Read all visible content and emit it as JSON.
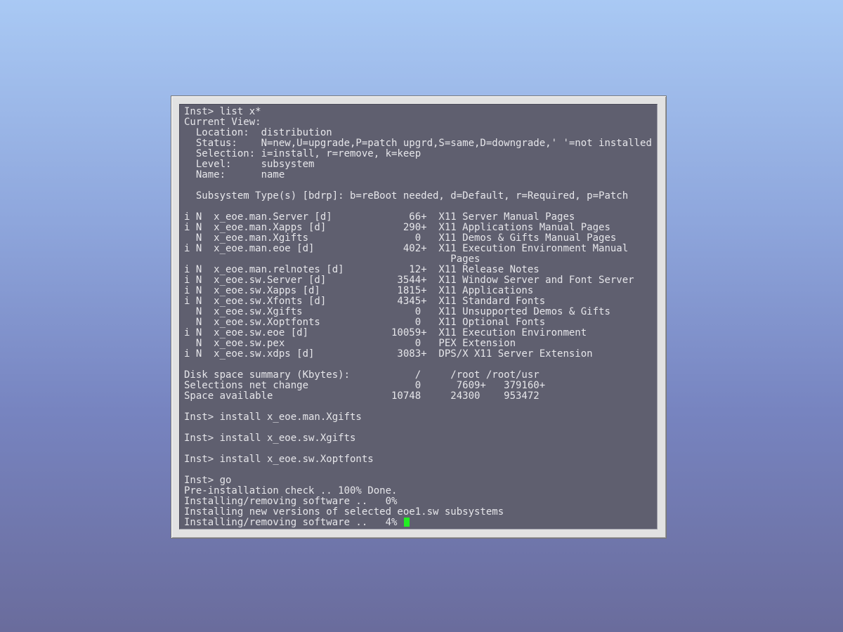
{
  "terminal": {
    "lines": [
      "Inst> list x*",
      "Current View:",
      "  Location:  distribution",
      "  Status:    N=new,U=upgrade,P=patch upgrd,S=same,D=downgrade,' '=not installed",
      "  Selection: i=install, r=remove, k=keep",
      "  Level:     subsystem",
      "  Name:      name",
      "",
      "  Subsystem Type(s) [bdrp]: b=reBoot needed, d=Default, r=Required, p=Patch",
      "",
      "i N  x_eoe.man.Server [d]             66+  X11 Server Manual Pages",
      "i N  x_eoe.man.Xapps [d]             290+  X11 Applications Manual Pages",
      "  N  x_eoe.man.Xgifts                  0   X11 Demos & Gifts Manual Pages",
      "i N  x_eoe.man.eoe [d]               402+  X11 Execution Environment Manual",
      "                                             Pages",
      "i N  x_eoe.man.relnotes [d]           12+  X11 Release Notes",
      "i N  x_eoe.sw.Server [d]            3544+  X11 Window Server and Font Server",
      "i N  x_eoe.sw.Xapps [d]             1815+  X11 Applications",
      "i N  x_eoe.sw.Xfonts [d]            4345+  X11 Standard Fonts",
      "  N  x_eoe.sw.Xgifts                   0   X11 Unsupported Demos & Gifts",
      "  N  x_eoe.sw.Xoptfonts                0   X11 Optional Fonts",
      "i N  x_eoe.sw.eoe [d]              10059+  X11 Execution Environment",
      "  N  x_eoe.sw.pex                      0   PEX Extension",
      "i N  x_eoe.sw.xdps [d]              3083+  DPS/X X11 Server Extension",
      "",
      "Disk space summary (Kbytes):           /     /root /root/usr",
      "Selections net change                  0      7609+   379160+",
      "Space available                    10748     24300    953472",
      "",
      "Inst> install x_eoe.man.Xgifts",
      "",
      "Inst> install x_eoe.sw.Xgifts",
      "",
      "Inst> install x_eoe.sw.Xoptfonts",
      "",
      "Inst> go",
      "Pre-installation check .. 100% Done.",
      "Installing/removing software ..   0%",
      "Installing new versions of selected eoe1.sw subsystems"
    ],
    "last_line": "Installing/removing software ..   4% ",
    "cursor_color": "#22ee22"
  }
}
